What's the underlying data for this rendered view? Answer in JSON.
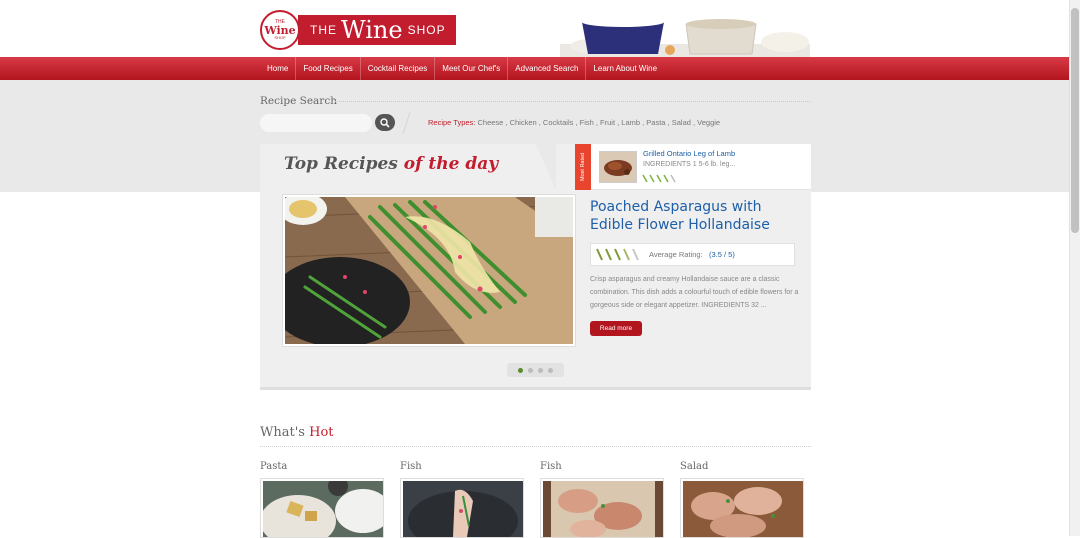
{
  "logo": {
    "circle_top": "THE",
    "circle_main": "Wine",
    "circle_bottom": "SHOP",
    "banner_the": "THE",
    "banner_wine": "Wine",
    "banner_shop": "SHOP"
  },
  "nav": [
    "Home",
    "Food Recipes",
    "Cocktail Recipes",
    "Meet Our Chef's",
    "Advanced Search",
    "Learn About Wine"
  ],
  "search": {
    "title": "Recipe Search",
    "placeholder": "",
    "types_label": "Recipe Types:",
    "types": "Cheese , Chicken , Cocktails , Fish , Fruit , Lamb , Pasta , Salad , Veggie"
  },
  "top_recipes": {
    "title_part1": "Top Recipes",
    "title_part2": "of the day",
    "most_rated_label": "Most Rated",
    "most_rated_title": "Grilled Ontario Leg of Lamb",
    "most_rated_excerpt": "INGREDIENTS 1 5-6 lb. leg...",
    "featured_title": "Poached Asparagus with Edible Flower Hollandaise",
    "rating_label": "Average Rating:",
    "rating_value": "(3.5 / 5)",
    "rating_score": 3.5,
    "rating_max": 5,
    "description": "Crisp asparagus and creamy Hollandaise sauce are a classic combination. This dish adds a colourful touch of edible flowers for a gorgeous side or elegant appetizer. INGREDIENTS 32 ...",
    "read_more": "Read more",
    "slides": 4,
    "active_slide": 1
  },
  "whats_hot": {
    "title_part1": "What's",
    "title_part2": "Hot",
    "categories": [
      "Pasta",
      "Fish",
      "Fish",
      "Salad"
    ]
  },
  "colors": {
    "brand_red": "#c21d2e",
    "link_blue": "#1d5fa8",
    "ribbon_orange": "#e8442e"
  }
}
